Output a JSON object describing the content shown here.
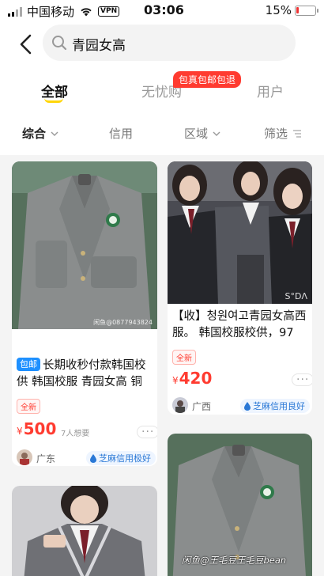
{
  "status_bar": {
    "carrier": "中国移动",
    "vpn": "VPN",
    "time": "03:06",
    "battery_pct": "15%",
    "battery_level": 0.15
  },
  "search": {
    "query": "青园女高"
  },
  "tabs": {
    "items": [
      "全部",
      "无忧购",
      "用户"
    ],
    "promo_badge": "包真包邮包退"
  },
  "filters": [
    "综合",
    "信用",
    "区域",
    "筛选"
  ],
  "items": [
    {
      "badge": "包邮",
      "title": "长期收秒付款韩国校供 韩国校服 青园女高 铜",
      "watermark": "闲鱼@0877943824",
      "new_tag": "全新",
      "price_currency": "¥",
      "price": "500",
      "wants": "7人想要",
      "more": "···",
      "location": "广东",
      "credit": "芝麻信用极好"
    },
    {
      "badge": "",
      "title": "【收】청원여고青园女高西服。 韩国校服校供，97",
      "watermark": "S°DΛ",
      "new_tag": "全新",
      "price_currency": "¥",
      "price": "420",
      "wants": "",
      "more": "···",
      "location": "广西",
      "credit": "芝麻信用良好"
    }
  ],
  "overlay_watermark": "闲鱼@王毛豆王毛豆bean",
  "colors": {
    "accent_yellow": "#ffd60a",
    "price_red": "#ff3b30",
    "credit_blue": "#2a78d6",
    "badge_blue": "#1e90ff"
  }
}
